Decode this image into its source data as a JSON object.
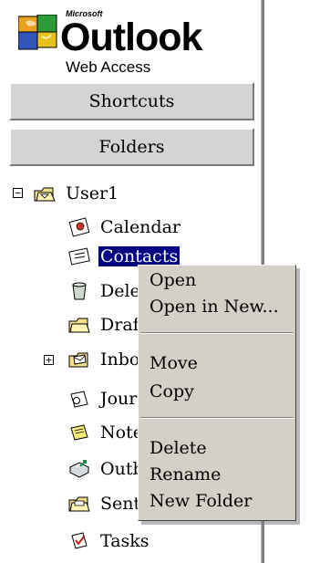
{
  "logo": {
    "vendor": "Microsoft",
    "name": "Outlook",
    "subtitle": "Web Access"
  },
  "nav": {
    "shortcuts_label": "Shortcuts",
    "folders_label": "Folders"
  },
  "tree": {
    "root": {
      "label": "User1",
      "expanded": true,
      "icon": "mailbox-icon"
    },
    "items": [
      {
        "label": "Calendar",
        "icon": "calendar-icon"
      },
      {
        "label": "Contacts",
        "icon": "contacts-icon",
        "selected": true
      },
      {
        "label": "Deleted Items",
        "icon": "deleted-items-icon"
      },
      {
        "label": "Drafts",
        "icon": "drafts-folder-icon"
      },
      {
        "label": "Inbox",
        "icon": "inbox-icon",
        "expandable": true
      },
      {
        "label": "Journal",
        "icon": "journal-icon"
      },
      {
        "label": "Notes",
        "icon": "notes-icon"
      },
      {
        "label": "Outbox",
        "icon": "outbox-icon"
      },
      {
        "label": "Sent Items",
        "icon": "sent-items-icon"
      },
      {
        "label": "Tasks",
        "icon": "tasks-icon"
      }
    ]
  },
  "context_menu": {
    "group1": [
      "Open",
      "Open in New..."
    ],
    "group2": [
      "Move",
      "Copy"
    ],
    "group3": [
      "Delete",
      "Rename",
      "New Folder"
    ]
  },
  "colors": {
    "selection": "#000080",
    "button_face": "#d4d4d4",
    "menu_face": "#d4d0c8"
  }
}
